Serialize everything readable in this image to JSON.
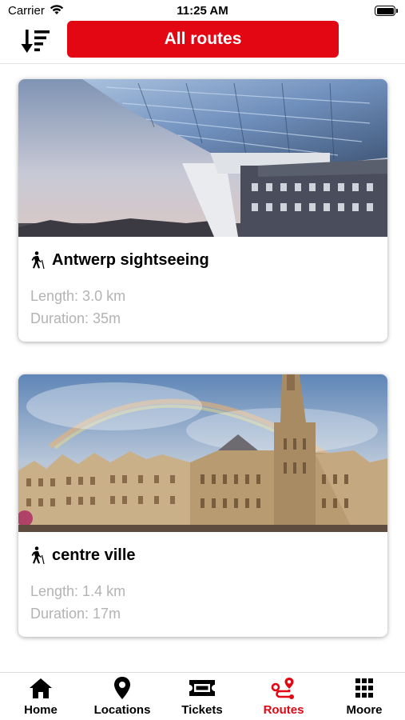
{
  "status_bar": {
    "carrier": "Carrier",
    "time": "11:25 AM"
  },
  "header": {
    "title_button": "All routes",
    "sort_icon": "sort-descending-icon"
  },
  "colors": {
    "accent": "#e30613",
    "muted_text": "#b3b3b3"
  },
  "routes": [
    {
      "name": "Antwerp sightseeing",
      "length": "Length: 3.0 km",
      "duration": "Duration: 35m",
      "mode_icon": "walking-icon",
      "image": "photo of modern glass building over historic harbour house"
    },
    {
      "name": "centre ville",
      "length": "Length: 1.4 km",
      "duration": "Duration: 17m",
      "mode_icon": "walking-icon",
      "image": "photo of Grand Place town hall with rainbow"
    }
  ],
  "tabs": [
    {
      "label": "Home",
      "icon": "home-icon",
      "active": false
    },
    {
      "label": "Locations",
      "icon": "location-pin-icon",
      "active": false
    },
    {
      "label": "Tickets",
      "icon": "ticket-icon",
      "active": false
    },
    {
      "label": "Routes",
      "icon": "route-icon",
      "active": true
    },
    {
      "label": "Moore",
      "icon": "grid-icon",
      "active": false
    }
  ]
}
